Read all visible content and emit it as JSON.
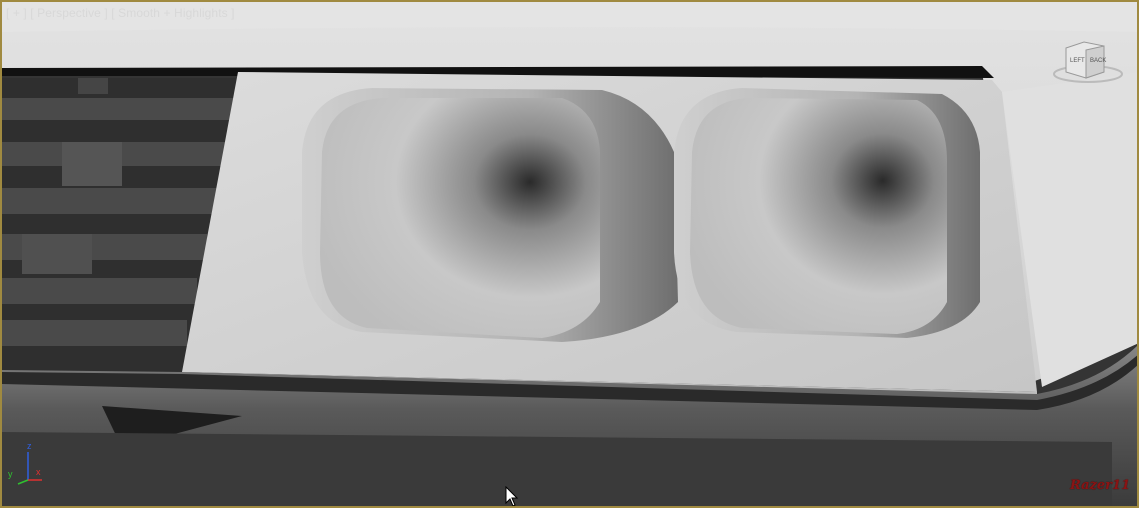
{
  "viewport": {
    "label_parts": [
      "[ + ]",
      "[ Perspective ]",
      "[ Smooth + Highlights ]"
    ]
  },
  "viewcube": {
    "faces": [
      "LEFT",
      "BACK"
    ]
  },
  "axis": {
    "x": "x",
    "y": "y",
    "z": "z",
    "colors": {
      "x": "#e03030",
      "y": "#30c030",
      "z": "#3060e0"
    }
  },
  "watermark": {
    "text": "Razer11",
    "color": "#8a1414"
  },
  "colors": {
    "frame": "#a08a40",
    "model": "#d6d6d6",
    "background": "#333333"
  },
  "icons": {
    "cursor": "arrow-cursor-icon",
    "viewcube": "viewcube-icon",
    "axis": "axis-tripod-icon"
  }
}
